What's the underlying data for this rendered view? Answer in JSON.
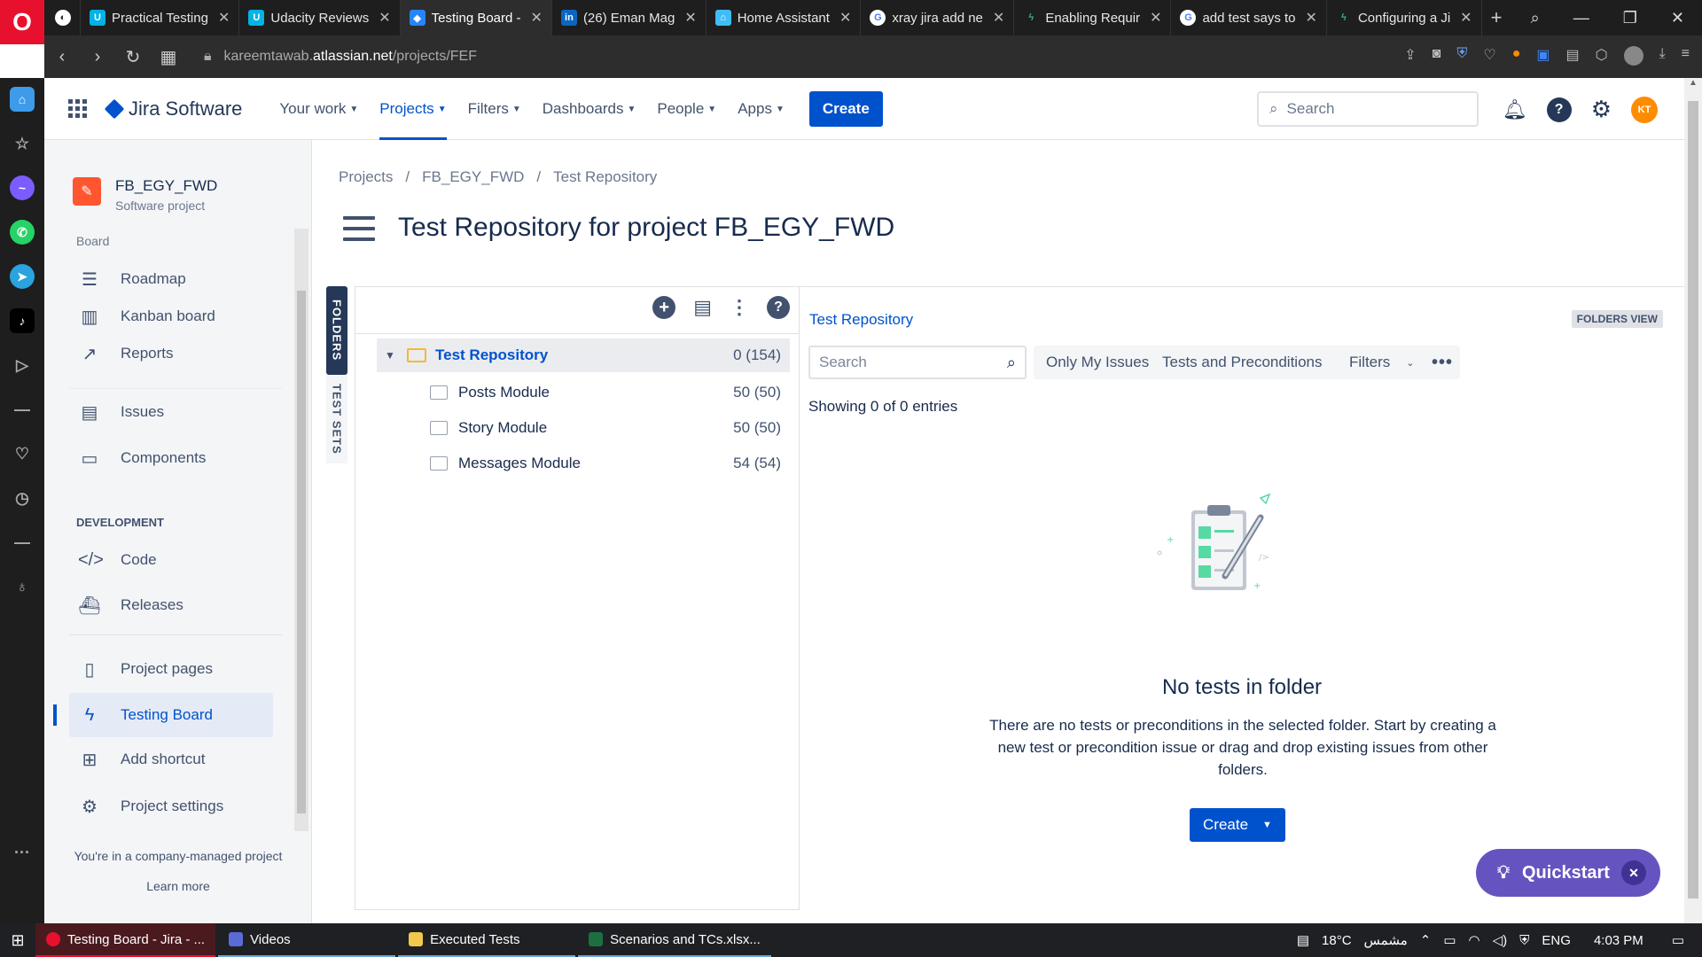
{
  "browser": {
    "tabs": [
      {
        "label": "Practical Testing",
        "icon": "udacity-icon",
        "active": false
      },
      {
        "label": "Udacity Reviews",
        "icon": "udacity-icon",
        "active": false
      },
      {
        "label": "Testing Board -",
        "icon": "jira-icon",
        "active": true
      },
      {
        "label": "(26) Eman Mag",
        "icon": "linkedin-icon",
        "active": false
      },
      {
        "label": "Home Assistant",
        "icon": "home-assistant-icon",
        "active": false
      },
      {
        "label": "xray jira add ne",
        "icon": "google-icon",
        "active": false
      },
      {
        "label": "Enabling Requir",
        "icon": "lightning-icon",
        "active": false
      },
      {
        "label": "add test says to",
        "icon": "google-icon",
        "active": false
      },
      {
        "label": "Configuring a Ji",
        "icon": "lightning-icon",
        "active": false
      }
    ],
    "url_prefix": "kareemtawab.",
    "url_domain": "atlassian.net",
    "url_path": "/projects/FEF"
  },
  "topnav": {
    "product": "Jira Software",
    "items": [
      {
        "label": "Your work",
        "selected": false
      },
      {
        "label": "Projects",
        "selected": true
      },
      {
        "label": "Filters",
        "selected": false
      },
      {
        "label": "Dashboards",
        "selected": false
      },
      {
        "label": "People",
        "selected": false
      },
      {
        "label": "Apps",
        "selected": false
      }
    ],
    "create_label": "Create",
    "search_placeholder": "Search",
    "avatar_initials": "KT"
  },
  "sidebar": {
    "project_name": "FB_EGY_FWD",
    "project_type": "Software project",
    "board_label": "Board",
    "items": [
      {
        "label": "Roadmap",
        "icon": "roadmap-icon"
      },
      {
        "label": "Kanban board",
        "icon": "kanban-icon"
      },
      {
        "label": "Reports",
        "icon": "reports-icon"
      },
      {
        "label": "Issues",
        "icon": "issues-icon"
      },
      {
        "label": "Components",
        "icon": "components-icon"
      }
    ],
    "development_heading": "DEVELOPMENT",
    "dev_items": [
      {
        "label": "Code",
        "icon": "code-icon"
      },
      {
        "label": "Releases",
        "icon": "releases-icon"
      }
    ],
    "bottom_items": [
      {
        "label": "Project pages",
        "icon": "pages-icon"
      },
      {
        "label": "Testing Board",
        "icon": "lightning-icon",
        "selected": true
      },
      {
        "label": "Add shortcut",
        "icon": "add-shortcut-icon"
      },
      {
        "label": "Project settings",
        "icon": "gear-icon"
      }
    ],
    "footer_text": "You're in a company-managed project",
    "learn_more": "Learn more"
  },
  "main": {
    "breadcrumbs": [
      "Projects",
      "FB_EGY_FWD",
      "Test Repository"
    ],
    "title": "Test Repository for project FB_EGY_FWD",
    "vertical_tabs": [
      "FOLDERS",
      "TEST SETS"
    ],
    "tree": {
      "root": {
        "name": "Test Repository",
        "count": "0 (154)"
      },
      "children": [
        {
          "name": "Posts Module",
          "count": "50 (50)"
        },
        {
          "name": "Story Module",
          "count": "50 (50)"
        },
        {
          "name": "Messages Module",
          "count": "54 (54)"
        }
      ]
    },
    "right": {
      "crumb": "Test Repository",
      "view_badge": "FOLDERS VIEW",
      "search_placeholder": "Search",
      "only_my_issues": "Only My Issues",
      "type_filter": "Tests and Preconditions",
      "filters_label": "Filters",
      "showing": "Showing 0 of 0 entries",
      "empty_title": "No tests in folder",
      "empty_text": "There are no tests or preconditions in the selected folder. Start by creating a new test or precondition issue or drag and drop existing issues from other folders.",
      "create_label": "Create"
    }
  },
  "quickstart": {
    "label": "Quickstart"
  },
  "taskbar": {
    "items": [
      "Testing Board - Jira - ...",
      "Videos",
      "Executed Tests",
      "Scenarios and TCs.xlsx..."
    ],
    "weather": "18°C",
    "weather_text": "مشمس",
    "lang": "ENG",
    "time": "4:03 PM"
  },
  "colors": {
    "accent": "#0052cc",
    "quickstart": "#6554c0",
    "opera": "#e8112d"
  }
}
